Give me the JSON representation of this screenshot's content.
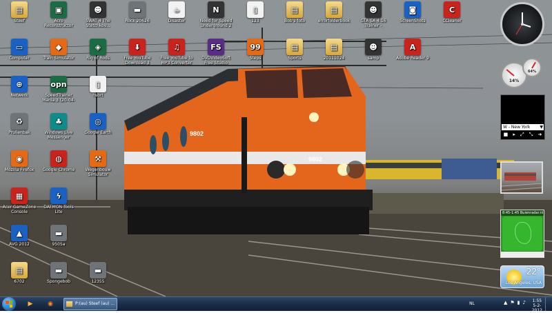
{
  "desktop": {
    "icons": [
      {
        "label": "Steef",
        "glyph": "▤",
        "style": "i-folder"
      },
      {
        "label": "Acro Reconstructor",
        "glyph": "▣",
        "style": "i-green"
      },
      {
        "label": "SWAT 4 The Stetchkov...",
        "glyph": "☻",
        "style": "i-dark"
      },
      {
        "label": "Rock 20626",
        "glyph": "▬",
        "style": "i-gray"
      },
      {
        "label": "Disaster",
        "glyph": "☕",
        "style": "i-file"
      },
      {
        "label": "Need for Speed Underground 2",
        "glyph": "N",
        "style": "i-dark"
      },
      {
        "label": "123",
        "glyph": "▯",
        "style": "i-file"
      },
      {
        "label": "Bob's foto",
        "glyph": "▤",
        "style": "i-folder"
      },
      {
        "label": "errorfolderbook",
        "glyph": "▤",
        "style": "i-folder"
      },
      {
        "label": "GTA SA 4:16 Trainer - Download",
        "glyph": "☻",
        "style": "i-dark"
      },
      {
        "label": "ScreenShots",
        "glyph": "◙",
        "style": "i-blue"
      },
      {
        "label": "CCleaner",
        "glyph": "C",
        "style": "i-red"
      },
      {
        "label": "Computer",
        "glyph": "▭",
        "style": "i-blue"
      },
      {
        "label": "Train Simulator",
        "glyph": "◆",
        "style": "i-orange"
      },
      {
        "label": "Rig of Rods",
        "glyph": "◈",
        "style": "i-green"
      },
      {
        "label": "Free YouTube Download 3",
        "glyph": "⬇",
        "style": "i-red"
      },
      {
        "label": "Free YouTube to MP3 Converter",
        "glyph": "♫",
        "style": "i-red"
      },
      {
        "label": "DVDVideoSoft Free Studio",
        "glyph": "FS",
        "style": "i-purple"
      },
      {
        "label": "Steps",
        "glyph": "99",
        "style": "i-orange"
      },
      {
        "label": "Sports",
        "glyph": "▤",
        "style": "i-folder"
      },
      {
        "label": "20111024",
        "glyph": "▤",
        "style": "i-folder"
      },
      {
        "label": "samp",
        "glyph": "☻",
        "style": "i-dark"
      },
      {
        "label": "Adobe Reader 9",
        "glyph": "A",
        "style": "i-red"
      },
      {
        "label": "Netwerk",
        "glyph": "⊕",
        "style": "i-blue"
      },
      {
        "label": "SpeedTrainer Mania 3 (20-04-2011)",
        "glyph": "opn",
        "style": "i-green"
      },
      {
        "label": "hsbrt",
        "glyph": "▯",
        "style": "i-file"
      },
      {
        "label": "Prullenbak",
        "glyph": "♻",
        "style": "i-gray"
      },
      {
        "label": "Windows Live Messenger",
        "glyph": "♣",
        "style": "i-teal"
      },
      {
        "label": "Google Earth",
        "glyph": "◎",
        "style": "i-blue"
      },
      {
        "label": "Mozilla Firefox",
        "glyph": "◉",
        "style": "i-orange"
      },
      {
        "label": "Google Chrome",
        "glyph": "◍",
        "style": "i-red"
      },
      {
        "label": "Wegenbouw Simulator",
        "glyph": "⚒",
        "style": "i-orange"
      },
      {
        "label": "Acer GameZone Console",
        "glyph": "▦",
        "style": "i-red"
      },
      {
        "label": "DAEMON Tools Lite",
        "glyph": "ϟ",
        "style": "i-blue"
      },
      {
        "label": "AVG 2012",
        "glyph": "▲",
        "style": "i-blue"
      },
      {
        "label": "9505a",
        "glyph": "▬",
        "style": "i-gray"
      },
      {
        "label": "6702",
        "glyph": "▤",
        "style": "i-folder"
      },
      {
        "label": "Spongebob",
        "glyph": "▬",
        "style": "i-gray"
      },
      {
        "label": "12355",
        "glyph": "▬",
        "style": "i-gray"
      }
    ]
  },
  "wallpaper": {
    "locomotive_number": "9802",
    "locomotive_cab_number": "9802",
    "colors": {
      "loco_orange": "#e4651c",
      "loco_white": "#e8e8e8",
      "roof": "#2b2e33"
    }
  },
  "gadgets": {
    "clock": {
      "icon": "analog-clock"
    },
    "cpu_meter": {
      "values": [
        "14%",
        "64%"
      ]
    },
    "video": {
      "channel": "W - New York",
      "controls": [
        "■",
        "▸",
        "⤢",
        "⤡",
        "➜"
      ]
    },
    "radar": {
      "header": "8:45-1:45 Buienradar.nl"
    },
    "weather": {
      "temperature": "22°",
      "city": "Los Angeles, USA"
    }
  },
  "taskbar": {
    "pinned": [
      {
        "name": "media-player-icon",
        "glyph": "▶"
      },
      {
        "name": "firefox-icon",
        "glyph": "◉"
      }
    ],
    "active_task": "P:(au) Steef (au) ...",
    "language": "NL",
    "tray_icons": [
      "▲",
      "⚑",
      "▮",
      "♪"
    ],
    "time": "1:55",
    "date": "5-2-2012"
  }
}
